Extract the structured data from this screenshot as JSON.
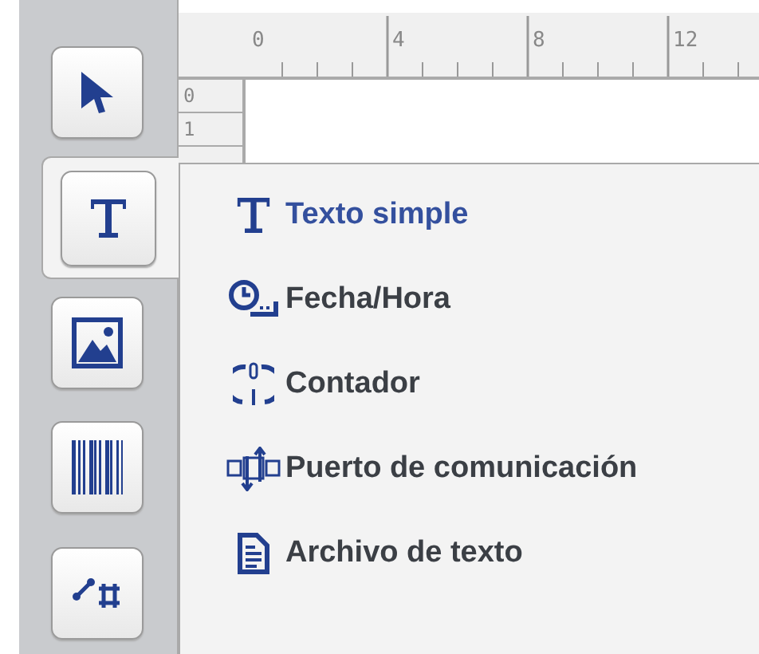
{
  "tools": [
    {
      "kind": "pointer",
      "selected": false
    },
    {
      "kind": "text",
      "selected": true
    },
    {
      "kind": "image",
      "selected": false
    },
    {
      "kind": "barcode",
      "selected": false
    },
    {
      "kind": "shape",
      "selected": false
    }
  ],
  "ruler": {
    "labels": [
      "0",
      "4",
      "8",
      "12"
    ]
  },
  "row_numbers": [
    "0",
    "1"
  ],
  "menu": {
    "items": [
      {
        "kind": "text",
        "label": "Texto simple",
        "selected": true
      },
      {
        "kind": "clock",
        "label": "Fecha/Hora",
        "selected": false
      },
      {
        "kind": "counter",
        "label": "Contador",
        "selected": false
      },
      {
        "kind": "port",
        "label": "Puerto de comunicación",
        "selected": false
      },
      {
        "kind": "file",
        "label": "Archivo de texto",
        "selected": false
      }
    ]
  }
}
